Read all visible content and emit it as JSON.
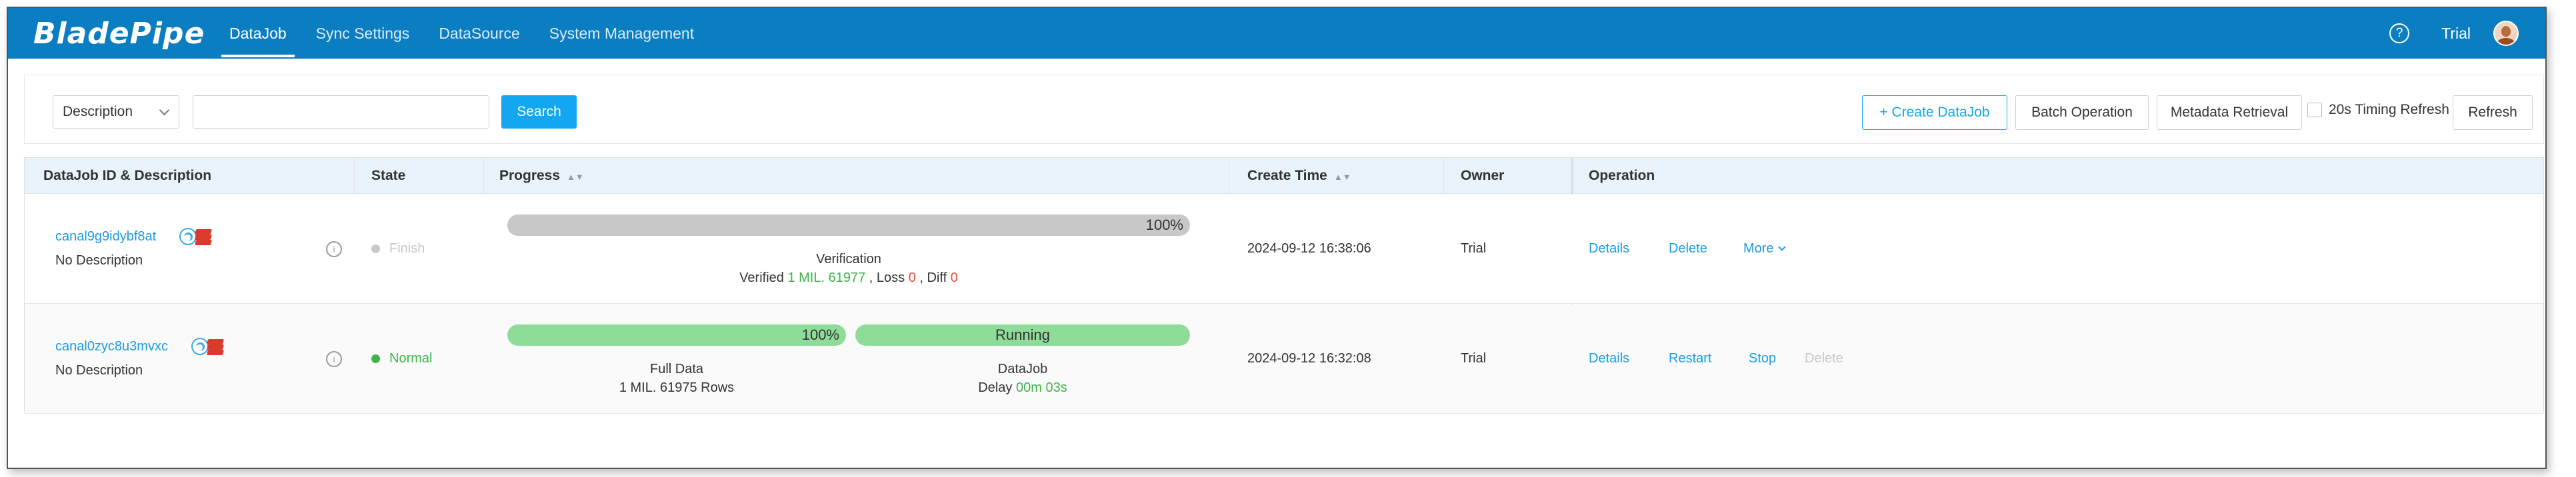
{
  "app": {
    "logo": "BladePipe",
    "nav": [
      "DataJob",
      "Sync Settings",
      "DataSource",
      "System Management"
    ],
    "active_nav": "DataJob",
    "user_name": "Trial"
  },
  "toolbar": {
    "filter_select": "Description",
    "search_value": "",
    "search_label": "Search",
    "create_label": "+ Create DataJob",
    "batch_label": "Batch Operation",
    "metadata_label": "Metadata Retrieval",
    "timing_refresh_label": "20s Timing Refresh",
    "timing_refresh_checked": false,
    "refresh_label": "Refresh"
  },
  "table": {
    "headers": {
      "id": "DataJob ID & Description",
      "state": "State",
      "progress": "Progress",
      "create_time": "Create Time",
      "owner": "Owner",
      "operation": "Operation"
    },
    "rows": [
      {
        "id": "canal9g9idybf8at",
        "description": "No Description",
        "state": "Finish",
        "state_color": "#c8c8c8",
        "progress_percent": "100%",
        "progress_fill": 1.0,
        "stage": "Verification",
        "verified_prefix": "Verified",
        "verified_value": "1 MIL. 61977",
        "loss_prefix": ", Loss",
        "loss_value": "0",
        "diff_prefix": ", Diff",
        "diff_value": "0",
        "create_time": "2024-09-12 16:38:06",
        "owner": "Trial",
        "ops": [
          "Details",
          "Delete",
          "More"
        ]
      },
      {
        "id": "canal0zyc8u3mvxc",
        "description": "No Description",
        "state": "Normal",
        "state_color": "#3db34a",
        "full_percent": "100%",
        "full_fill": 1.0,
        "full_label": "Full Data",
        "full_rows": "1 MIL. 61975 Rows",
        "incr_status": "Running",
        "incr_label": "DataJob",
        "delay_prefix": "Delay",
        "delay_value": "00m 03s",
        "create_time": "2024-09-12 16:32:08",
        "owner": "Trial",
        "ops": [
          "Details",
          "Restart",
          "Stop",
          "Delete"
        ]
      }
    ]
  },
  "colors": {
    "brand": "#0b7dc1",
    "accent": "#12a7f0",
    "link": "#1b9be0",
    "success": "#3db34a",
    "danger": "#e94b3c",
    "progress_done_gray": "#c8c8c8",
    "progress_green": "#8fdc9a"
  }
}
